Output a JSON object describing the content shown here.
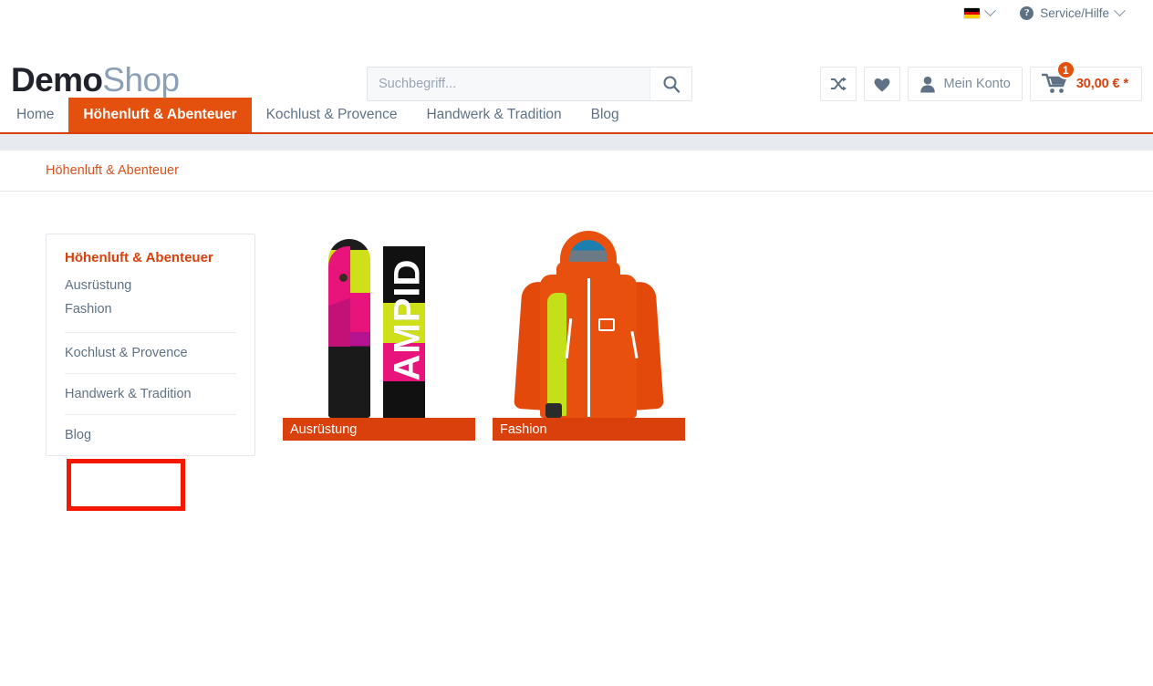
{
  "topbar": {
    "language": {
      "icon": "german-flag-icon",
      "label": "",
      "chevron": "chevron-down-icon"
    },
    "service": {
      "icon": "question-mark-icon",
      "label": "Service/Hilfe",
      "chevron": "chevron-down-icon"
    }
  },
  "header": {
    "logo": {
      "part1": "Demo",
      "part2": "Shop"
    },
    "search": {
      "placeholder": "Suchbegriff...",
      "value": "",
      "icon": "search-icon"
    },
    "actions": {
      "compare": {
        "icon": "compare-shuffle-icon",
        "label": ""
      },
      "wishlist": {
        "icon": "heart-icon",
        "label": ""
      },
      "account": {
        "icon": "user-icon",
        "label": "Mein Konto"
      },
      "cart": {
        "icon": "shopping-cart-icon",
        "price": "30,00 € *",
        "badge": "1"
      }
    }
  },
  "nav": {
    "items": [
      {
        "label": "Home",
        "active": false
      },
      {
        "label": "Höhenluft & Abenteuer",
        "active": true
      },
      {
        "label": "Kochlust & Provence",
        "active": false
      },
      {
        "label": "Handwerk & Tradition",
        "active": false
      },
      {
        "label": "Blog",
        "active": false
      }
    ]
  },
  "breadcrumb": {
    "items": [
      {
        "label": "Höhenluft & Abenteuer"
      }
    ]
  },
  "sidebar": {
    "title": "Höhenluft & Abenteuer",
    "subitems": [
      {
        "label": "Ausrüstung"
      },
      {
        "label": "Fashion"
      }
    ],
    "items": [
      {
        "label": "Kochlust & Provence"
      },
      {
        "label": "Handwerk & Tradition"
      },
      {
        "label": "Blog"
      }
    ]
  },
  "tiles": [
    {
      "label": "Ausrüstung",
      "image": "skis-product-image",
      "ski_text": "AMPID"
    },
    {
      "label": "Fashion",
      "image": "orange-ski-jacket-image"
    }
  ],
  "annotation": {
    "type": "red-highlight-box",
    "target": "sidebar-subcategories"
  },
  "colors": {
    "accent_orange": "#d9400b",
    "nav_active": "#e4510f",
    "text_slate": "#5f7285",
    "logo_dark": "#20232b",
    "logo_light": "#8ba0b6",
    "annotation_red": "#f51800",
    "gray_strip": "#e7eaee"
  }
}
